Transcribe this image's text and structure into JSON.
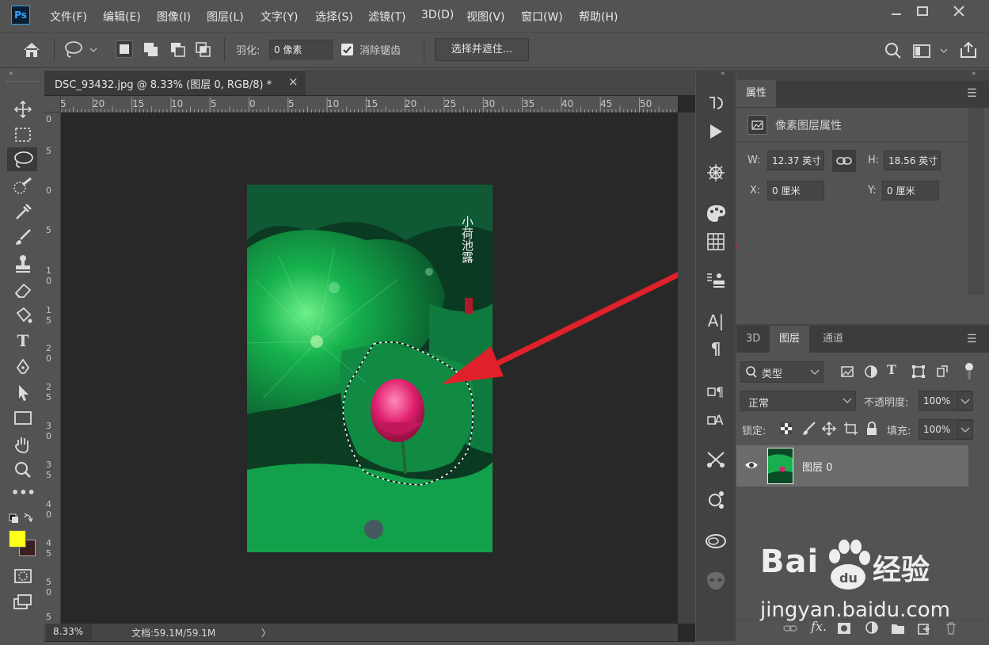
{
  "app": {
    "logo": "Ps"
  },
  "menu": [
    "文件(F)",
    "编辑(E)",
    "图像(I)",
    "图层(L)",
    "文字(Y)",
    "选择(S)",
    "滤镜(T)",
    "3D(D)",
    "视图(V)",
    "窗口(W)",
    "帮助(H)"
  ],
  "window_buttons": [
    "minimize-icon",
    "restore-icon",
    "close-icon"
  ],
  "options": {
    "feather_label": "羽化:",
    "feather_value": "0 像素",
    "antialias_label": "消除锯齿",
    "antialias_checked": true,
    "select_mask_button": "选择并遮住..."
  },
  "document": {
    "tab_title": "DSC_93432.jpg @ 8.33% (图层 0, RGB/8) *",
    "close": "×",
    "zoom": "8.33%",
    "doc_info": "文档:59.1M/59.1M",
    "status_arrow": "〉",
    "h_ruler": [
      "5",
      "20",
      "15",
      "10",
      "5",
      "0",
      "5",
      "10",
      "15",
      "20",
      "25",
      "30",
      "35",
      "40",
      "45",
      "50"
    ],
    "v_ruler": [
      "0",
      "5",
      "0",
      "5",
      "1\n0",
      "1\n5",
      "2\n0",
      "2\n5",
      "3\n0",
      "3\n5",
      "4\n0",
      "4\n5",
      "5\n0",
      "5"
    ],
    "image_text": "小荷池露"
  },
  "colors": {
    "foreground": "#ffff1a",
    "background": "#3a1f1f",
    "accent": "#e0202a"
  },
  "properties": {
    "tab": "属性",
    "section": "像素图层属性",
    "w_label": "W:",
    "w_value": "12.37 英寸",
    "h_label": "H:",
    "h_value": "18.56 英寸",
    "x_label": "X:",
    "x_value": "0 厘米",
    "y_label": "Y:",
    "y_value": "0 厘米"
  },
  "layers": {
    "tabs": [
      "3D",
      "图层",
      "通道"
    ],
    "active_tab": "图层",
    "filter_kind": "类型",
    "blend_mode": "正常",
    "opacity_label": "不透明度:",
    "opacity_value": "100%",
    "lock_label": "锁定:",
    "fill_label": "填充:",
    "fill_value": "100%",
    "items": [
      {
        "name": "图层 0",
        "visible": true
      }
    ]
  },
  "watermark": {
    "brand": "Bai",
    "brand2": "经验",
    "url": "jingyan.baidu.com"
  }
}
